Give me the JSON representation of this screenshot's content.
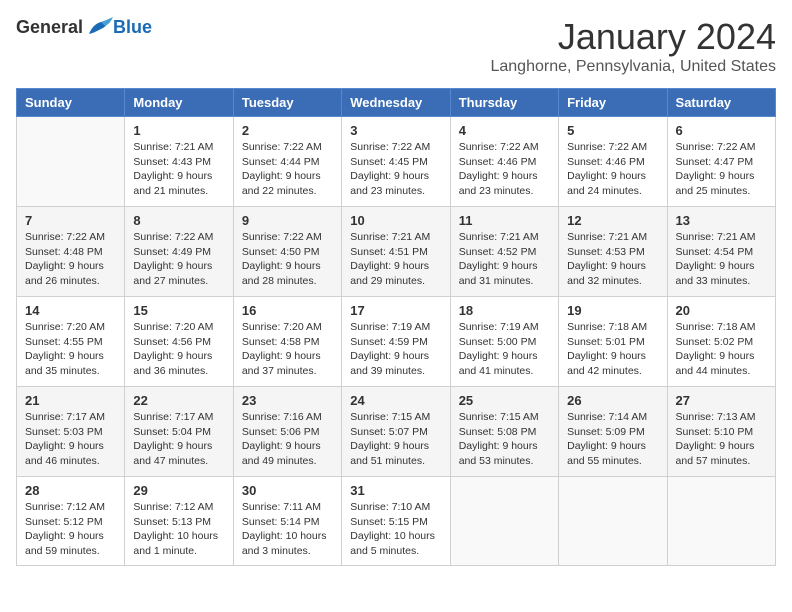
{
  "header": {
    "logo_general": "General",
    "logo_blue": "Blue",
    "month_title": "January 2024",
    "location": "Langhorne, Pennsylvania, United States"
  },
  "days_of_week": [
    "Sunday",
    "Monday",
    "Tuesday",
    "Wednesday",
    "Thursday",
    "Friday",
    "Saturday"
  ],
  "weeks": [
    [
      {
        "day": "",
        "info": ""
      },
      {
        "day": "1",
        "info": "Sunrise: 7:21 AM\nSunset: 4:43 PM\nDaylight: 9 hours\nand 21 minutes."
      },
      {
        "day": "2",
        "info": "Sunrise: 7:22 AM\nSunset: 4:44 PM\nDaylight: 9 hours\nand 22 minutes."
      },
      {
        "day": "3",
        "info": "Sunrise: 7:22 AM\nSunset: 4:45 PM\nDaylight: 9 hours\nand 23 minutes."
      },
      {
        "day": "4",
        "info": "Sunrise: 7:22 AM\nSunset: 4:46 PM\nDaylight: 9 hours\nand 23 minutes."
      },
      {
        "day": "5",
        "info": "Sunrise: 7:22 AM\nSunset: 4:46 PM\nDaylight: 9 hours\nand 24 minutes."
      },
      {
        "day": "6",
        "info": "Sunrise: 7:22 AM\nSunset: 4:47 PM\nDaylight: 9 hours\nand 25 minutes."
      }
    ],
    [
      {
        "day": "7",
        "info": "Sunrise: 7:22 AM\nSunset: 4:48 PM\nDaylight: 9 hours\nand 26 minutes."
      },
      {
        "day": "8",
        "info": "Sunrise: 7:22 AM\nSunset: 4:49 PM\nDaylight: 9 hours\nand 27 minutes."
      },
      {
        "day": "9",
        "info": "Sunrise: 7:22 AM\nSunset: 4:50 PM\nDaylight: 9 hours\nand 28 minutes."
      },
      {
        "day": "10",
        "info": "Sunrise: 7:21 AM\nSunset: 4:51 PM\nDaylight: 9 hours\nand 29 minutes."
      },
      {
        "day": "11",
        "info": "Sunrise: 7:21 AM\nSunset: 4:52 PM\nDaylight: 9 hours\nand 31 minutes."
      },
      {
        "day": "12",
        "info": "Sunrise: 7:21 AM\nSunset: 4:53 PM\nDaylight: 9 hours\nand 32 minutes."
      },
      {
        "day": "13",
        "info": "Sunrise: 7:21 AM\nSunset: 4:54 PM\nDaylight: 9 hours\nand 33 minutes."
      }
    ],
    [
      {
        "day": "14",
        "info": "Sunrise: 7:20 AM\nSunset: 4:55 PM\nDaylight: 9 hours\nand 35 minutes."
      },
      {
        "day": "15",
        "info": "Sunrise: 7:20 AM\nSunset: 4:56 PM\nDaylight: 9 hours\nand 36 minutes."
      },
      {
        "day": "16",
        "info": "Sunrise: 7:20 AM\nSunset: 4:58 PM\nDaylight: 9 hours\nand 37 minutes."
      },
      {
        "day": "17",
        "info": "Sunrise: 7:19 AM\nSunset: 4:59 PM\nDaylight: 9 hours\nand 39 minutes."
      },
      {
        "day": "18",
        "info": "Sunrise: 7:19 AM\nSunset: 5:00 PM\nDaylight: 9 hours\nand 41 minutes."
      },
      {
        "day": "19",
        "info": "Sunrise: 7:18 AM\nSunset: 5:01 PM\nDaylight: 9 hours\nand 42 minutes."
      },
      {
        "day": "20",
        "info": "Sunrise: 7:18 AM\nSunset: 5:02 PM\nDaylight: 9 hours\nand 44 minutes."
      }
    ],
    [
      {
        "day": "21",
        "info": "Sunrise: 7:17 AM\nSunset: 5:03 PM\nDaylight: 9 hours\nand 46 minutes."
      },
      {
        "day": "22",
        "info": "Sunrise: 7:17 AM\nSunset: 5:04 PM\nDaylight: 9 hours\nand 47 minutes."
      },
      {
        "day": "23",
        "info": "Sunrise: 7:16 AM\nSunset: 5:06 PM\nDaylight: 9 hours\nand 49 minutes."
      },
      {
        "day": "24",
        "info": "Sunrise: 7:15 AM\nSunset: 5:07 PM\nDaylight: 9 hours\nand 51 minutes."
      },
      {
        "day": "25",
        "info": "Sunrise: 7:15 AM\nSunset: 5:08 PM\nDaylight: 9 hours\nand 53 minutes."
      },
      {
        "day": "26",
        "info": "Sunrise: 7:14 AM\nSunset: 5:09 PM\nDaylight: 9 hours\nand 55 minutes."
      },
      {
        "day": "27",
        "info": "Sunrise: 7:13 AM\nSunset: 5:10 PM\nDaylight: 9 hours\nand 57 minutes."
      }
    ],
    [
      {
        "day": "28",
        "info": "Sunrise: 7:12 AM\nSunset: 5:12 PM\nDaylight: 9 hours\nand 59 minutes."
      },
      {
        "day": "29",
        "info": "Sunrise: 7:12 AM\nSunset: 5:13 PM\nDaylight: 10 hours\nand 1 minute."
      },
      {
        "day": "30",
        "info": "Sunrise: 7:11 AM\nSunset: 5:14 PM\nDaylight: 10 hours\nand 3 minutes."
      },
      {
        "day": "31",
        "info": "Sunrise: 7:10 AM\nSunset: 5:15 PM\nDaylight: 10 hours\nand 5 minutes."
      },
      {
        "day": "",
        "info": ""
      },
      {
        "day": "",
        "info": ""
      },
      {
        "day": "",
        "info": ""
      }
    ]
  ]
}
